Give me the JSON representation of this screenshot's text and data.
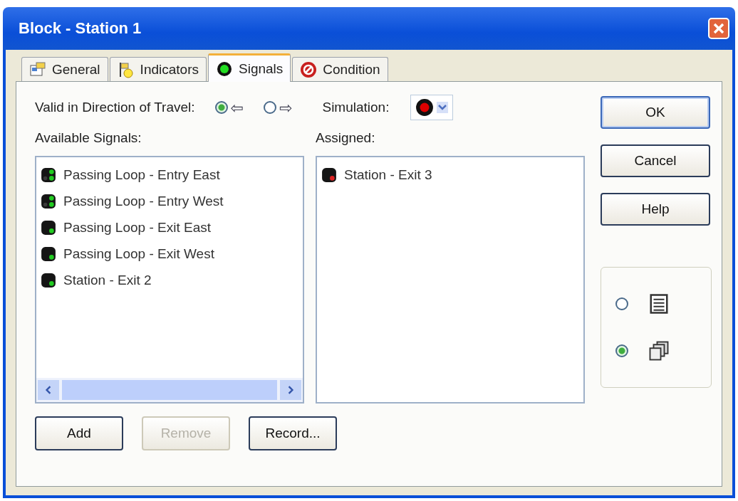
{
  "window": {
    "title": "Block - Station 1"
  },
  "tabs": [
    {
      "label": "General",
      "selected": false,
      "kind": "general"
    },
    {
      "label": "Indicators",
      "selected": false,
      "kind": "indicators"
    },
    {
      "label": "Signals",
      "selected": true,
      "kind": "signals"
    },
    {
      "label": "Condition",
      "selected": false,
      "kind": "condition"
    }
  ],
  "direction": {
    "label": "Valid in Direction of Travel:",
    "options": [
      {
        "arrow": "⇦",
        "selected": true
      },
      {
        "arrow": "⇨",
        "selected": false
      }
    ]
  },
  "simulation": {
    "label": "Simulation:",
    "color": "#dd0000"
  },
  "available": {
    "label": "Available Signals:",
    "items": [
      {
        "text": "Passing Loop - Entry East",
        "kind": "double",
        "color": "#22cc22"
      },
      {
        "text": "Passing Loop - Entry West",
        "kind": "double",
        "color": "#22cc22"
      },
      {
        "text": "Passing Loop - Exit East",
        "kind": "single",
        "color": "#22cc22"
      },
      {
        "text": "Passing Loop - Exit West",
        "kind": "single",
        "color": "#22cc22"
      },
      {
        "text": "Station - Exit 2",
        "kind": "single",
        "color": "#22cc22"
      }
    ]
  },
  "assigned": {
    "label": "Assigned:",
    "items": [
      {
        "text": "Station - Exit 3",
        "kind": "single",
        "color": "#dd2222"
      }
    ]
  },
  "bottom_buttons": [
    {
      "label": "Add",
      "disabled": false
    },
    {
      "label": "Remove",
      "disabled": true
    },
    {
      "label": "Record...",
      "disabled": false
    }
  ],
  "side_buttons": [
    {
      "label": "OK",
      "default": true
    },
    {
      "label": "Cancel",
      "default": false
    },
    {
      "label": "Help",
      "default": false
    }
  ],
  "view": [
    {
      "kind": "list",
      "selected": false
    },
    {
      "kind": "cascade",
      "selected": true
    }
  ]
}
